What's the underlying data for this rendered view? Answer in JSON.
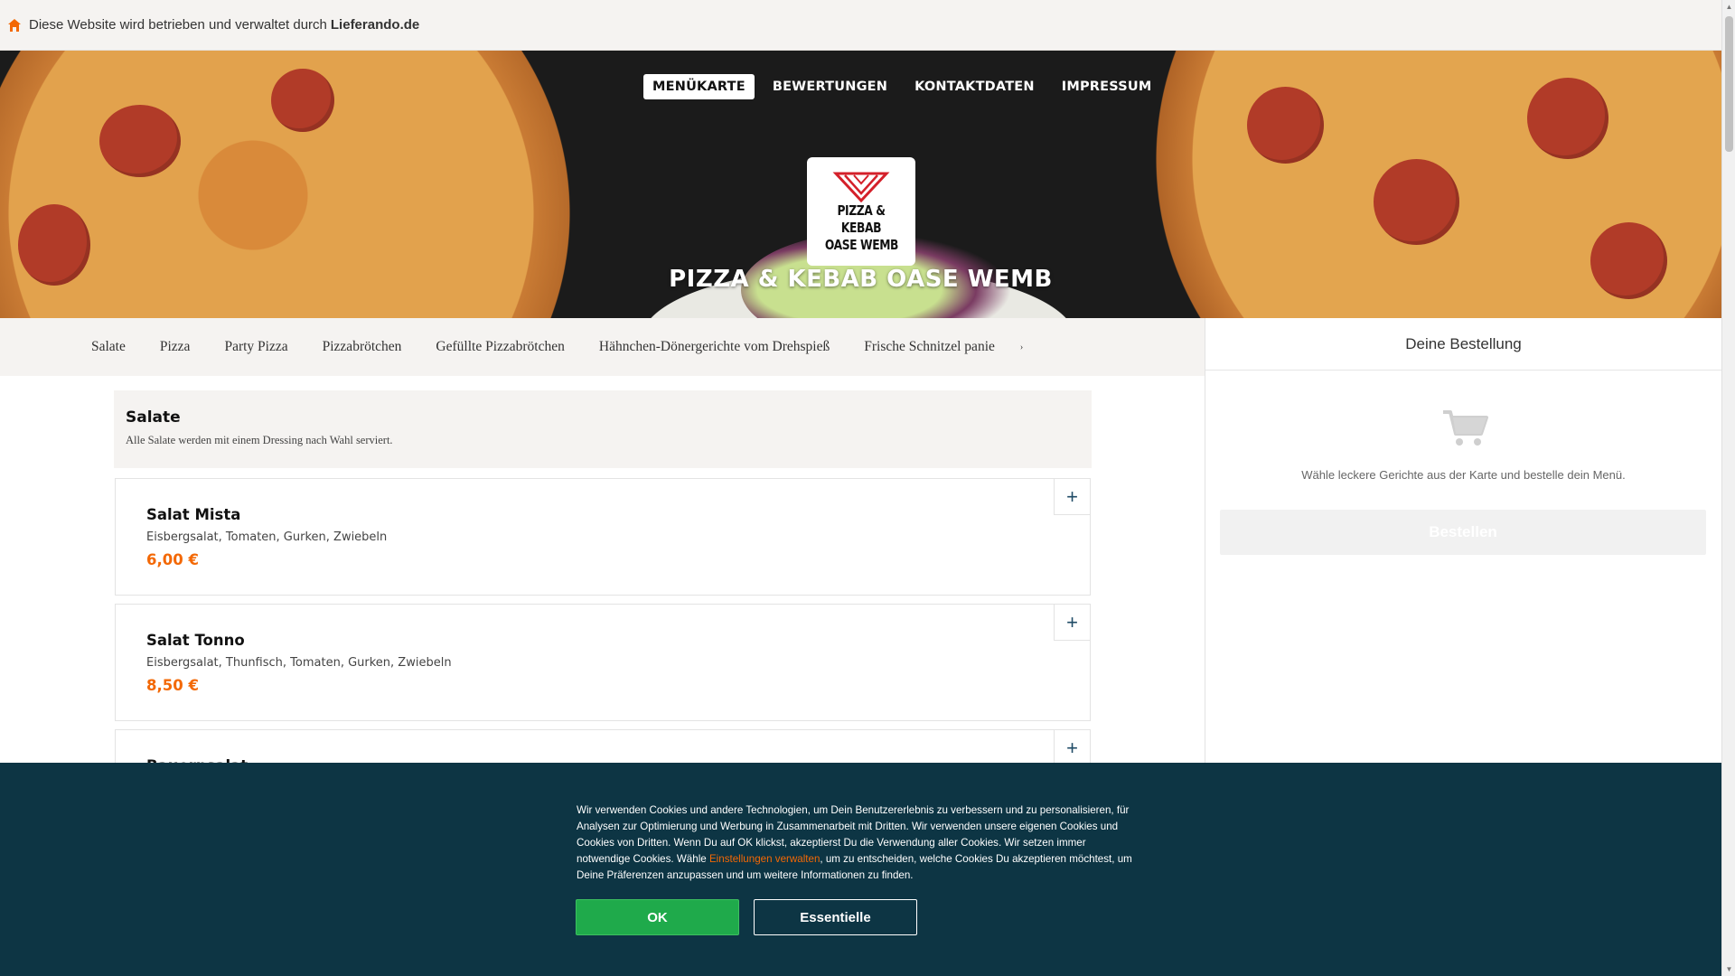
{
  "infobar": {
    "prefix": "Diese Website wird betrieben und verwaltet durch",
    "brand": "Lieferando.de"
  },
  "hero_nav": [
    "MENÜKARTE",
    "BEWERTUNGEN",
    "KONTAKTDATEN",
    "IMPRESSUM"
  ],
  "restaurant": {
    "name": "PIZZA & KEBAB OASE WEMB",
    "logo_line1": "PIZZA & KEBAB",
    "logo_line2": "OASE WEMB"
  },
  "categories": [
    "Salate",
    "Pizza",
    "Party Pizza",
    "Pizzabrötchen",
    "Gefüllte Pizzabrötchen",
    "Hähnchen-Dönergerichte vom Drehspieß",
    "Frische Schnitzel panie"
  ],
  "category_more": "›",
  "section": {
    "title": "Salate",
    "description": "Alle Salate werden mit einem Dressing nach Wahl serviert."
  },
  "dishes": [
    {
      "name": "Salat Mista",
      "description": "Eisbergsalat, Tomaten, Gurken, Zwiebeln",
      "price": "6,00 €"
    },
    {
      "name": "Salat Tonno",
      "description": "Eisbergsalat, Thunfisch, Tomaten, Gurken, Zwiebeln",
      "price": "8,50 €"
    },
    {
      "name": "Bauernsalat",
      "description": "",
      "price": ""
    }
  ],
  "add_label": "+",
  "basket": {
    "title": "Deine Bestellung",
    "empty_text": "Wähle leckere Gerichte aus der Karte und bestelle dein Menü.",
    "order_button": "Bestellen"
  },
  "cookie": {
    "text_before": "Wir verwenden Cookies und andere Technologien, um Dein Benutzererlebnis zu verbessern und zu personalisieren, für Analysen zur Optimierung und Werbung in Zusammenarbeit mit Dritten. Wir verwenden unsere eigenen Cookies und Cookies von Dritten. Wenn Du auf OK klickst, akzeptierst Du die Verwendung aller Cookies. Wir setzen immer notwendige Cookies. Wähle ",
    "link": "Einstellungen verwalten",
    "text_after": ", um zu entscheiden, welche Cookies Du akzeptieren möchtest, um Deine Präferenzen anzupassen und um weitere Informationen zu finden.",
    "ok": "OK",
    "essential": "Essentielle"
  },
  "colors": {
    "accent": "#f36805",
    "banner": "#0d3544",
    "ok_green": "#1faa4b",
    "panel": "#f5f3f1"
  },
  "icons": [
    "home-icon",
    "cart-icon",
    "plus-icon",
    "chevron-right-icon"
  ]
}
